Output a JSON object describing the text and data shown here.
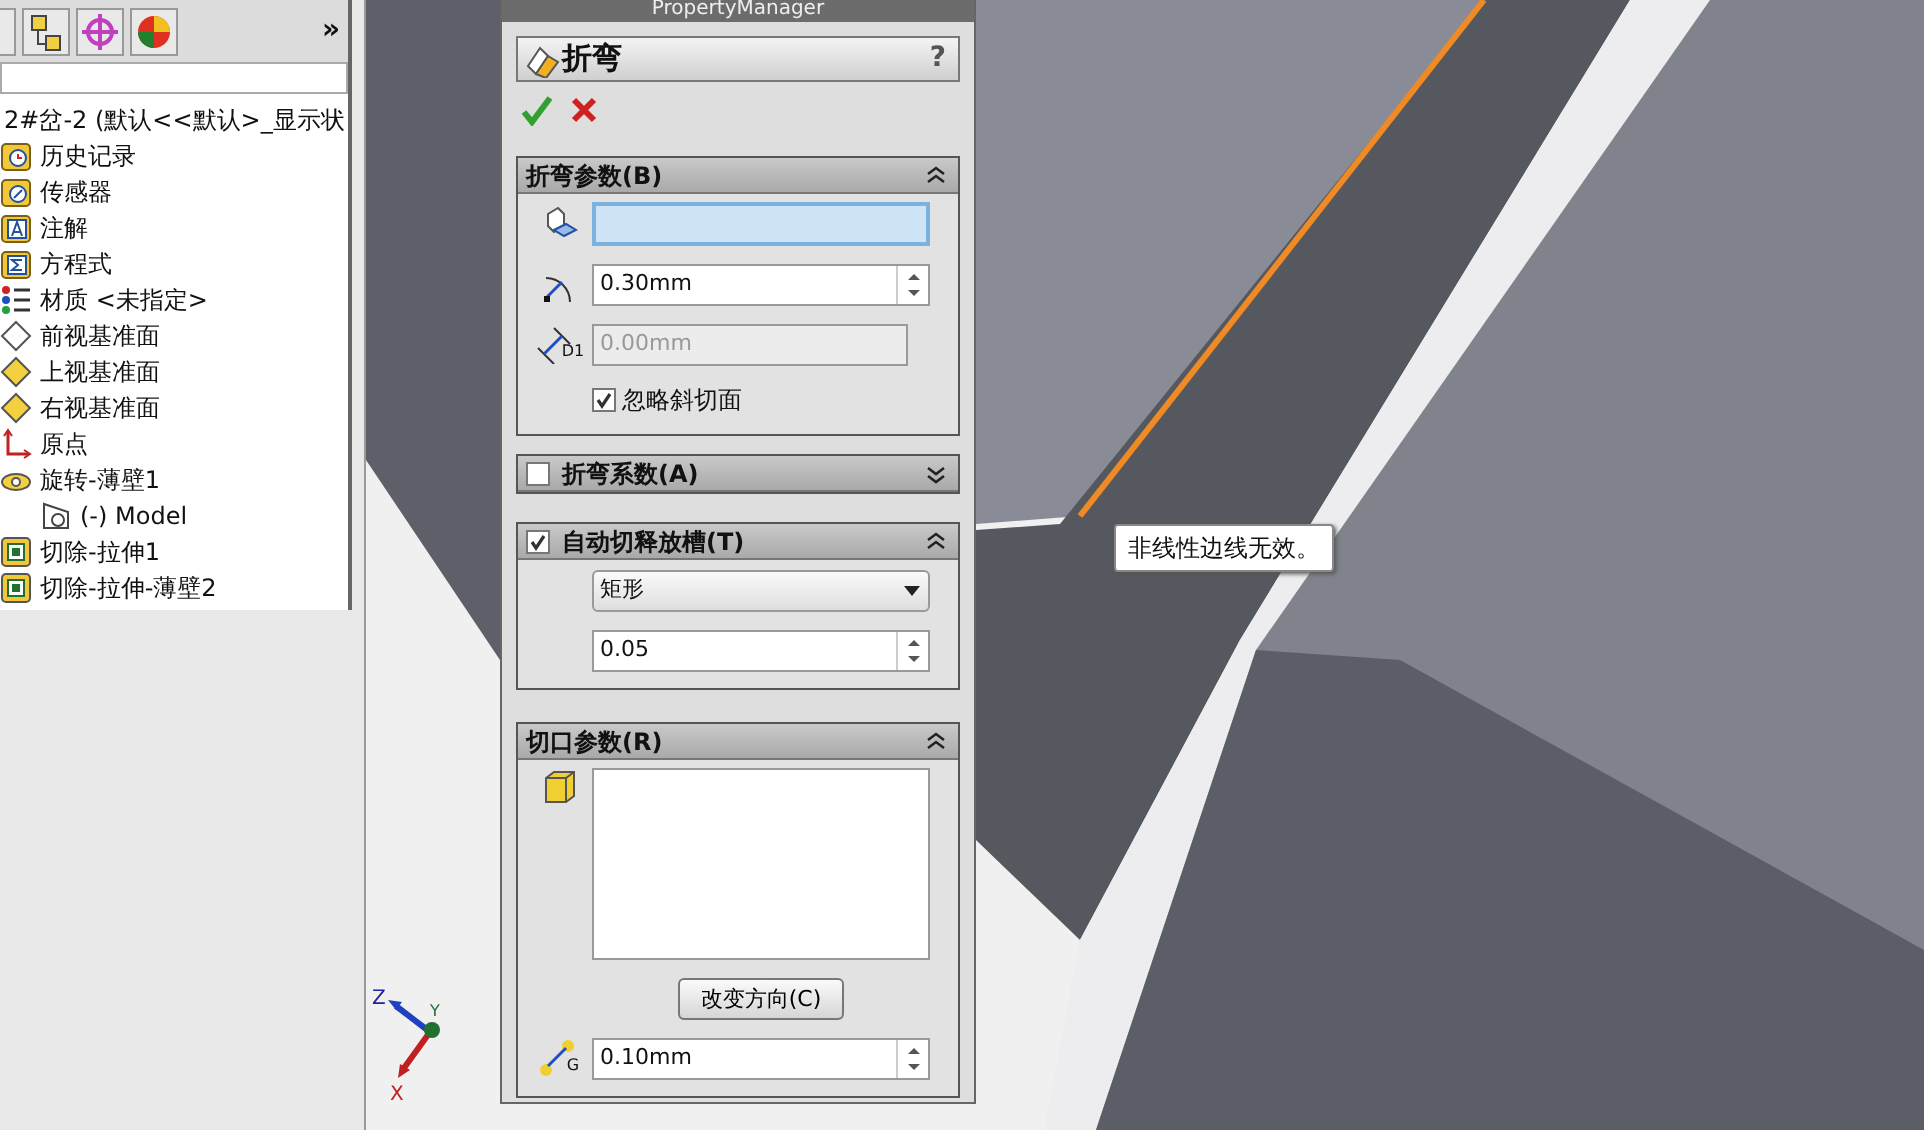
{
  "feature_tree": {
    "more": "»",
    "root": "2#岔-2 (默认<<默认>_显示状",
    "items": [
      {
        "kind": "history",
        "label": "历史记录"
      },
      {
        "kind": "sensor",
        "label": "传感器"
      },
      {
        "kind": "annotation",
        "label": "注解"
      },
      {
        "kind": "equation",
        "label": "方程式"
      },
      {
        "kind": "material",
        "label": "材质 <未指定>"
      },
      {
        "kind": "plane",
        "label": "前视基准面",
        "selected": false
      },
      {
        "kind": "plane",
        "label": "上视基准面",
        "selected": true
      },
      {
        "kind": "plane",
        "label": "右视基准面",
        "selected": true
      },
      {
        "kind": "origin",
        "label": "原点"
      },
      {
        "kind": "revolve",
        "label": "旋转-薄壁1",
        "children": [
          {
            "kind": "sketch",
            "label": "(-) Model"
          }
        ]
      },
      {
        "kind": "cut",
        "label": "切除-拉伸1"
      },
      {
        "kind": "cut",
        "label": "切除-拉伸-薄壁2"
      }
    ]
  },
  "property_manager": {
    "title": "PropertyManager",
    "feature": "折弯",
    "help": "?",
    "groups": [
      {
        "title": "折弯参数(B)",
        "has_checkbox": false,
        "expanded": true,
        "controls": [
          {
            "kind": "selection"
          },
          {
            "kind": "radius",
            "value": "0.30mm",
            "disabled": false,
            "spinner": true
          },
          {
            "kind": "distance",
            "icon_label": "D1",
            "value": "0.00mm",
            "disabled": true,
            "spinner": false
          },
          {
            "kind": "checkbox",
            "label": "忽略斜切面",
            "checked": true
          }
        ]
      },
      {
        "title": "折弯系数(A)",
        "has_checkbox": true,
        "checked": false,
        "expanded": false
      },
      {
        "title": "自动切释放槽(T)",
        "has_checkbox": true,
        "checked": true,
        "expanded": true,
        "controls": [
          {
            "kind": "dropdown",
            "value": "矩形"
          },
          {
            "kind": "ratio",
            "value": "0.05",
            "disabled": false,
            "spinner": true
          }
        ]
      },
      {
        "title": "切口参数(R)",
        "has_checkbox": false,
        "expanded": true,
        "controls": [
          {
            "kind": "listbox"
          },
          {
            "kind": "button",
            "label": "改变方向(C)"
          },
          {
            "kind": "gap",
            "icon_label": "G",
            "value": "0.10mm",
            "disabled": false,
            "spinner": true
          }
        ]
      }
    ]
  },
  "tooltip": "非线性边线无效。",
  "triad": {
    "z": "Z",
    "y": "Y",
    "x": "X"
  }
}
